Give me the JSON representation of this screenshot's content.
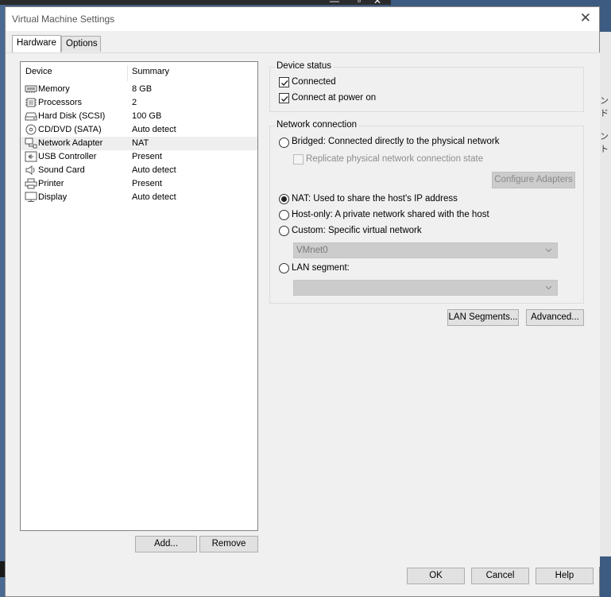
{
  "background": {
    "titlebar_controls": "— ❎ ✕",
    "right_edge_text_1": "ンド",
    "right_edge_text_2": "ント"
  },
  "window": {
    "title": "Virtual Machine Settings",
    "close_glyph": "✕"
  },
  "tabs": [
    {
      "label": "Hardware",
      "active": true
    },
    {
      "label": "Options",
      "active": false
    }
  ],
  "device_list": {
    "columns": [
      "Device",
      "Summary"
    ],
    "rows": [
      {
        "icon": "memory-icon",
        "device": "Memory",
        "summary": "8 GB"
      },
      {
        "icon": "processor-icon",
        "device": "Processors",
        "summary": "2"
      },
      {
        "icon": "hard-disk-icon",
        "device": "Hard Disk (SCSI)",
        "summary": "100 GB"
      },
      {
        "icon": "cd-dvd-icon",
        "device": "CD/DVD (SATA)",
        "summary": "Auto detect"
      },
      {
        "icon": "network-adapter-icon",
        "device": "Network Adapter",
        "summary": "NAT",
        "selected": true
      },
      {
        "icon": "usb-icon",
        "device": "USB Controller",
        "summary": "Present"
      },
      {
        "icon": "sound-card-icon",
        "device": "Sound Card",
        "summary": "Auto detect"
      },
      {
        "icon": "printer-icon",
        "device": "Printer",
        "summary": "Present"
      },
      {
        "icon": "display-icon",
        "device": "Display",
        "summary": "Auto detect"
      }
    ],
    "add_label": "Add...",
    "remove_label": "Remove"
  },
  "device_status": {
    "legend": "Device status",
    "connected": {
      "label": "Connected",
      "checked": true
    },
    "connect_at_power_on": {
      "label": "Connect at power on",
      "checked": true
    }
  },
  "network_connection": {
    "legend": "Network connection",
    "bridged": {
      "label": "Bridged: Connected directly to the physical network",
      "selected": false
    },
    "replicate": {
      "label": "Replicate physical network connection state",
      "checked": false,
      "enabled": false
    },
    "configure_adapters": "Configure Adapters",
    "nat": {
      "label": "NAT: Used to share the host's IP address",
      "selected": true
    },
    "host_only": {
      "label": "Host-only: A private network shared with the host",
      "selected": false
    },
    "custom": {
      "label": "Custom: Specific virtual network",
      "selected": false
    },
    "custom_value": "VMnet0",
    "lan_segment": {
      "label": "LAN segment:",
      "selected": false
    },
    "lan_value": ""
  },
  "lan_segments_button": "LAN Segments...",
  "advanced_button": "Advanced...",
  "footer": {
    "ok": "OK",
    "cancel": "Cancel",
    "help": "Help"
  }
}
